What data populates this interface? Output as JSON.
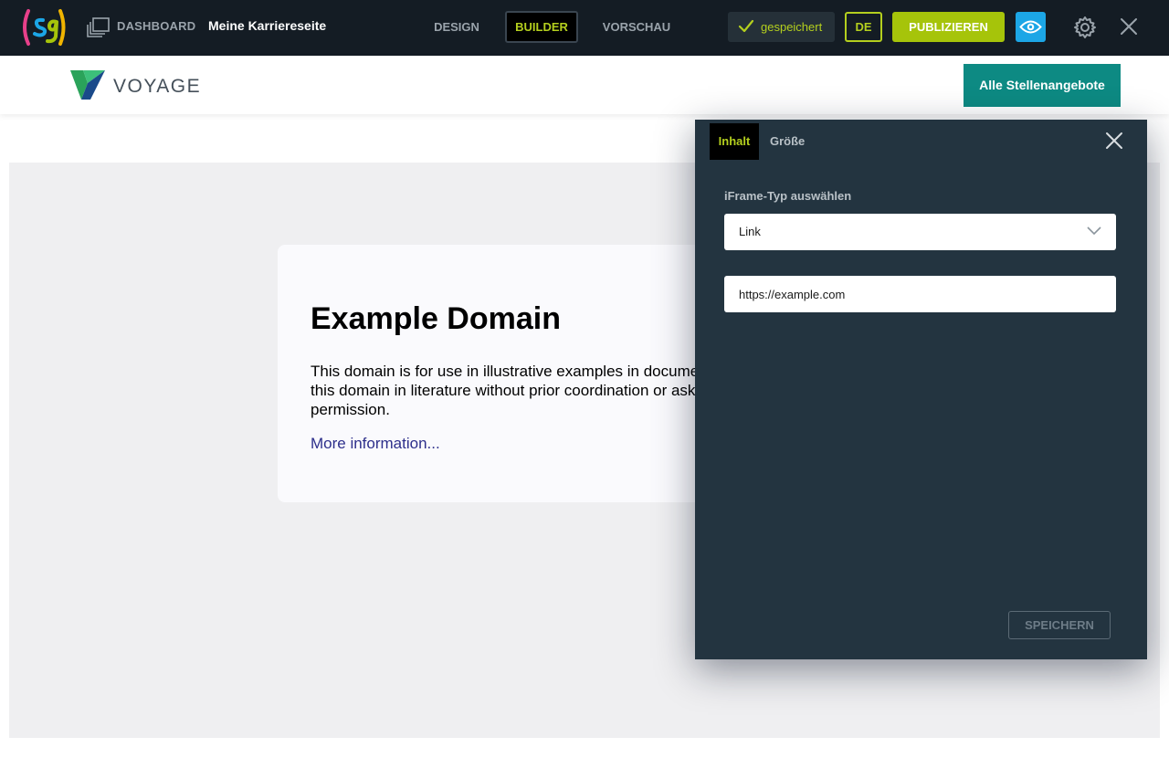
{
  "topbar": {
    "logo_text": "(sg)",
    "dashboard_label": "DASHBOARD",
    "site_name": "Meine Karriereseite",
    "tabs": [
      {
        "label": "DESIGN",
        "active": false
      },
      {
        "label": "BUILDER",
        "active": true
      },
      {
        "label": "VORSCHAU",
        "active": false
      }
    ],
    "saved_label": "gespeichert",
    "language": "DE",
    "publish_label": "PUBLIZIEREN",
    "icons": {
      "dashboard": "windows-stack-icon",
      "saved": "checkmark-icon",
      "preview": "eye-icon",
      "settings": "gear-icon",
      "close": "close-icon"
    }
  },
  "site": {
    "brand_name": "VOYAGE",
    "jobs_button_label": "Alle Stellenangebote"
  },
  "embedded_page": {
    "title": "Example Domain",
    "text": "This domain is for use in illustrative examples in documents. You may use this domain in literature without prior coordination or asking for permission.",
    "link_text": "More information..."
  },
  "dialog": {
    "tabs": [
      {
        "label": "Inhalt",
        "active": true
      },
      {
        "label": "Größe",
        "active": false
      }
    ],
    "type_label": "iFrame-Typ auswählen",
    "type_value": "Link",
    "url_value": "https://example.com",
    "save_label": "SPEICHERN"
  },
  "colors": {
    "topbar_bg": "#141c24",
    "accent_green": "#b4cf1e",
    "publish_green": "#a6c40a",
    "preview_blue": "#1ca6e6",
    "teal_button": "#0d8a83",
    "dialog_bg": "#233440"
  }
}
